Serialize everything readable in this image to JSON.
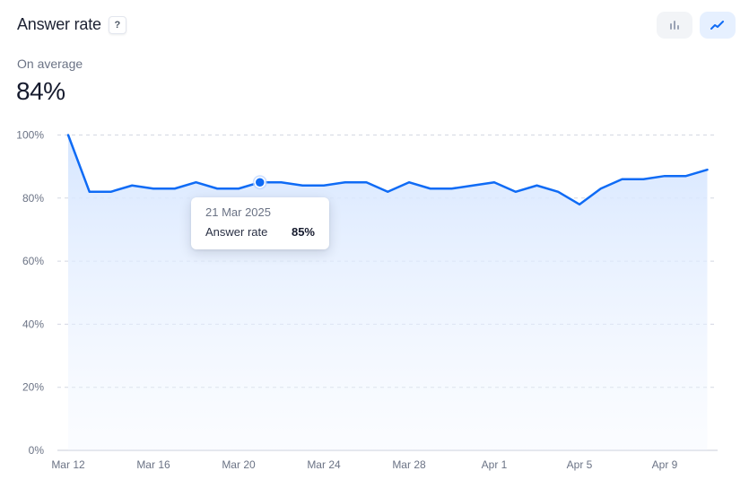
{
  "header": {
    "title": "Answer rate",
    "help_label": "?"
  },
  "view_toggles": [
    {
      "icon": "bar-chart-icon",
      "active": false
    },
    {
      "icon": "line-chart-icon",
      "active": true
    }
  ],
  "summary": {
    "label": "On average",
    "value": "84%"
  },
  "tooltip": {
    "date": "21 Mar 2025",
    "series_label": "Answer rate",
    "value": "85%"
  },
  "colors": {
    "line": "#0f6bf5",
    "fill": "#d9e7ff",
    "grid": "#d4d8e2",
    "tick_text": "#6b7385"
  },
  "chart_data": {
    "type": "area",
    "x": [
      "Mar 12",
      "Mar 13",
      "Mar 14",
      "Mar 15",
      "Mar 16",
      "Mar 17",
      "Mar 18",
      "Mar 19",
      "Mar 20",
      "Mar 21",
      "Mar 22",
      "Mar 23",
      "Mar 24",
      "Mar 25",
      "Mar 26",
      "Mar 27",
      "Mar 28",
      "Mar 29",
      "Mar 30",
      "Mar 31",
      "Apr 1",
      "Apr 2",
      "Apr 3",
      "Apr 4",
      "Apr 5",
      "Apr 6",
      "Apr 7",
      "Apr 8",
      "Apr 9",
      "Apr 10",
      "Apr 11"
    ],
    "series": [
      {
        "values": [
          100,
          82,
          82,
          84,
          83,
          83,
          85,
          83,
          83,
          85,
          85,
          84,
          84,
          85,
          85,
          82,
          85,
          83,
          83,
          84,
          85,
          82,
          84,
          82,
          78,
          83,
          86,
          86,
          87,
          87,
          89
        ]
      }
    ],
    "highlight_index": 9,
    "x_tick_labels": [
      "Mar 12",
      "Mar 16",
      "Mar 20",
      "Mar 24",
      "Mar 28",
      "Apr 1",
      "Apr 5",
      "Apr 9"
    ],
    "x_tick_indices": [
      0,
      4,
      8,
      12,
      16,
      20,
      24,
      28
    ],
    "y_ticks": [
      0,
      20,
      40,
      60,
      80,
      100
    ],
    "y_tick_labels": [
      "0%",
      "20%",
      "40%",
      "60%",
      "80%",
      "100%"
    ],
    "ylim": [
      0,
      100
    ],
    "grid": true
  }
}
